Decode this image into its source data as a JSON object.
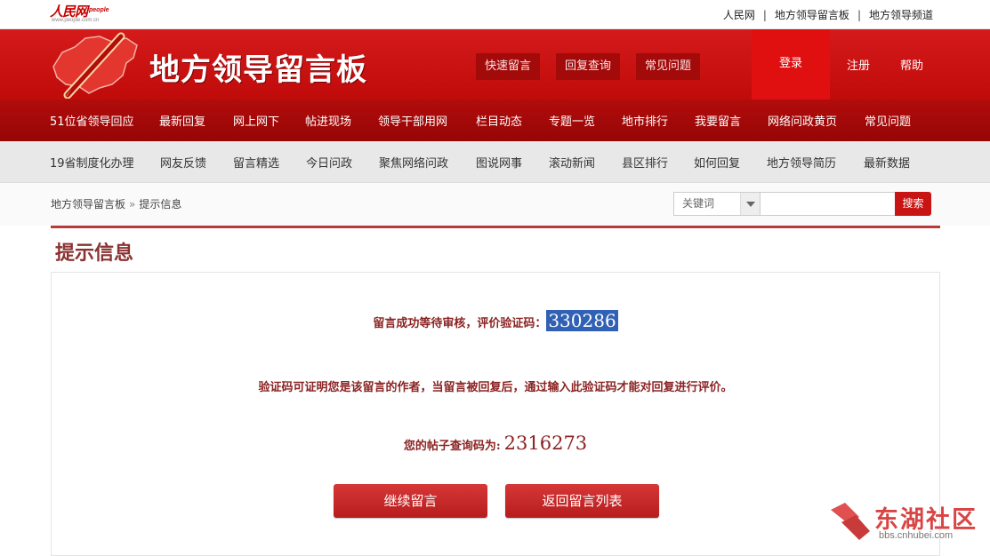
{
  "top_bar": {
    "logo_text": "人民网",
    "logo_en": "people",
    "logo_url": "www.people.com.cn",
    "links": [
      "人民网",
      "地方领导留言板",
      "地方领导频道"
    ]
  },
  "header": {
    "site_title": "地方领导留言板",
    "buttons": [
      "快速留言",
      "回复查询",
      "常见问题"
    ],
    "login": "登录",
    "register": "注册",
    "help": "帮助"
  },
  "nav_primary": [
    "51位省领导回应",
    "最新回复",
    "网上网下",
    "帖进现场",
    "领导干部用网",
    "栏目动态",
    "专题一览",
    "地市排行",
    "我要留言",
    "网络问政黄页",
    "常见问题"
  ],
  "nav_secondary": [
    "19省制度化办理",
    "网友反馈",
    "留言精选",
    "今日问政",
    "聚焦网络问政",
    "图说网事",
    "滚动新闻",
    "县区排行",
    "如何回复",
    "地方领导简历",
    "最新数据"
  ],
  "breadcrumb": {
    "home": "地方领导留言板",
    "separator": "»",
    "current": "提示信息"
  },
  "search": {
    "select_value": "关键词",
    "input_value": "",
    "button": "搜索"
  },
  "page_heading": "提示信息",
  "message": {
    "line1_prefix": "留言成功等待审核，评价验证码：",
    "verify_code": "330286",
    "line2": "验证码可证明您是该留言的作者，当留言被回复后，通过输入此验证码才能对回复进行评价。",
    "line3_prefix": "您的帖子查询码为:",
    "query_code": "2316273"
  },
  "actions": {
    "continue": "继续留言",
    "back_to_list": "返回留言列表"
  },
  "watermark": {
    "title": "东湖社区",
    "url": "bbs.cnhubei.com"
  },
  "colors": {
    "brand_red": "#c40000",
    "nav_red": "#a60909",
    "text_dark_red": "#8b2323",
    "highlight_blue": "#3161b4"
  }
}
